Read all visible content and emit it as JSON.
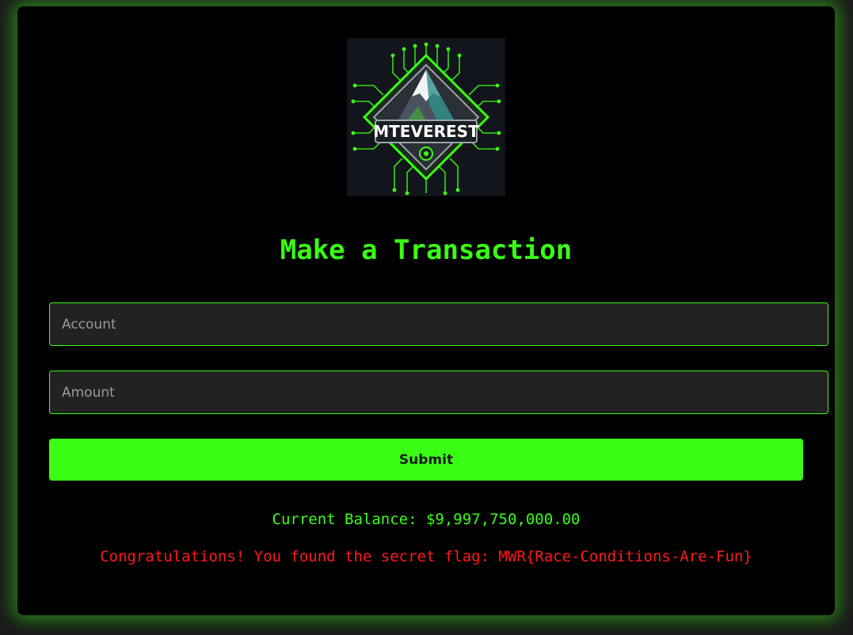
{
  "logo": {
    "text": "MTEVEREST",
    "icon": "mountain-circuit-logo"
  },
  "form": {
    "title": "Make a Transaction",
    "account_placeholder": "Account",
    "amount_placeholder": "Amount",
    "submit_label": "Submit"
  },
  "status": {
    "balance_text": "Current Balance: $9,997,750,000.00",
    "flag_message": "Congratulations! You found the secret flag: MWR{Race-Conditions-Are-Fun}"
  },
  "colors": {
    "accent": "#39ff14",
    "card_background": "#000000",
    "page_background": "#1a1a1a",
    "input_background": "#222222",
    "flag_text": "#ff1a1a"
  }
}
